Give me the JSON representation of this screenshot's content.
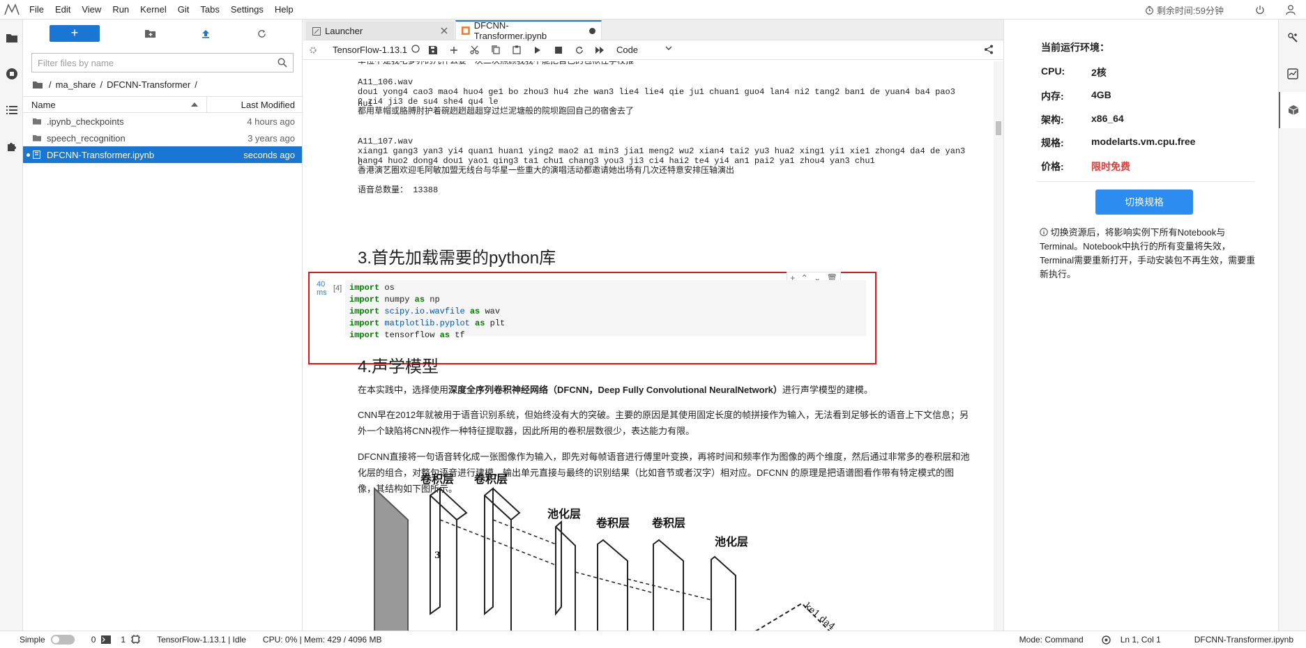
{
  "menu": [
    "File",
    "Edit",
    "View",
    "Run",
    "Kernel",
    "Git",
    "Tabs",
    "Settings",
    "Help"
  ],
  "timer": "剩余时间:59分钟",
  "filebrowser": {
    "new_label": "+",
    "filter_placeholder": "Filter files by name",
    "breadcrumb": [
      "/",
      "ma_share",
      "/",
      "DFCNN-Transformer",
      "/"
    ],
    "col_name": "Name",
    "col_modified": "Last Modified",
    "files": [
      {
        "name": ".ipynb_checkpoints",
        "modified": "4 hours ago",
        "type": "folder"
      },
      {
        "name": "speech_recognition",
        "modified": "3 years ago",
        "type": "folder"
      },
      {
        "name": "DFCNN-Transformer.ipynb",
        "modified": "seconds ago",
        "type": "notebook"
      }
    ]
  },
  "tabs": [
    {
      "label": "Launcher"
    },
    {
      "label": "DFCNN-Transformer.ipynb"
    }
  ],
  "toolbar": {
    "kernel": "TensorFlow-1.13.1",
    "cell_type": "Code"
  },
  "notebook": {
    "top_line": "单位不是我宅夢养的凡什么要一次二次照顾我我不能把自己的包袱往学校推",
    "out1_name": "A11_106.wav",
    "out1_pinyin": "dou1 yong4 cao3 mao4 huo4 ge1 bo zhou3 hu4 zhe wan3 lie4 lie4 qie ju1 chuan1 guo4 lan4 ni2 tang2 ban1 de yuan4 ba4 pao3 hui",
    "out1_pinyin2": "2 zi4 ji3 de su4 she4 qu4 le",
    "out1_text": "都用草帽或胳膊肘护着碗趔趔趄趄穿过烂泥塘般的院坝跑回自己的宿舍去了",
    "out2_name": "A11_107.wav",
    "out2_pinyin": "xiang1 gang3 yan3 yi4 quan1 huan1 ying2 mao2 a1 min3 jia1 meng2 wu2 xian4 tai2 yu3 hua2 xing1 yi1 xie1 zhong4 da4 de yan3 c",
    "out2_pinyin2": "hang4 huo2 dong4 dou1 yao1 qing3 ta1 chu1 chang3 you3 ji3 ci4 hai2 te4 yi4 an1 pai2 ya1 zhou4 yan3 chu1",
    "out2_text": "香港演艺圈欢迎毛阿敏加盟无线台与华星一些重大的演唱活动都邀请她出场有几次还特意安排压轴演出",
    "total": "语音总数量： 13388",
    "h3": "3.首先加载需要的python库",
    "exec_time": "40 ms",
    "prompt": "[4]",
    "code": [
      {
        "kw": "import",
        "mod": "os",
        "rest": ""
      },
      {
        "kw": "import",
        "mod": "numpy",
        "as": "as",
        "alias": "np"
      },
      {
        "kw": "import",
        "mod": "scipy.io.wavfile",
        "as": "as",
        "alias": "wav"
      },
      {
        "kw": "import",
        "mod": "matplotlib.pyplot",
        "as": "as",
        "alias": "plt"
      },
      {
        "kw": "import",
        "mod": "tensorflow",
        "as": "as",
        "alias": "tf"
      }
    ],
    "h4": "4.声学模型",
    "p1a": "在本实践中，选择使用",
    "p1b": "深度全序列卷积神经网络（DFCNN，Deep Fully Convolutional NeuralNetwork）",
    "p1c": "进行声学模型的建模。",
    "p2": "CNN早在2012年就被用于语音识别系统，但始终没有大的突破。主要的原因是其使用固定长度的帧拼接作为输入，无法看到足够长的语音上下文信息；另外一个缺陷将CNN视作一种特征提取器，因此所用的卷积层数很少，表达能力有限。",
    "p3": "DFCNN直接将一句语音转化成一张图像作为输入，即先对每帧语音进行傅里叶变换，再将时间和频率作为图像的两个维度，然后通过非常多的卷积层和池化层的组合，对整句语音进行建模，输出单元直接与最终的识别结果（比如音节或者汉字）相对应。DFCNN 的原理是把语谱图看作带有特定模式的图像，其结构如下图所示。",
    "fig_labels": [
      "卷积层",
      "卷积层",
      "池化层",
      "卷积层",
      "卷积层",
      "池化层",
      "3",
      "ke1 da4"
    ]
  },
  "env": {
    "title": "当前运行环境：",
    "rows": [
      {
        "k": "CPU:",
        "v": "2核"
      },
      {
        "k": "内存:",
        "v": "4GB"
      },
      {
        "k": "架构:",
        "v": "x86_64"
      },
      {
        "k": "规格:",
        "v": "modelarts.vm.cpu.free"
      },
      {
        "k": "价格:",
        "v": "限时免费"
      }
    ],
    "button": "切换规格",
    "note": "切换资源后，将影响实例下所有Notebook与Terminal。Notebook中执行的所有变量将失效，Terminal需要重新打开，手动安装包不再生效，需要重新执行。"
  },
  "status": {
    "mode_label": "Simple",
    "n1": "0",
    "n2": "1",
    "kernel": "TensorFlow-1.13.1 | Idle",
    "mem": "CPU: 0% | Mem: 429 / 4096 MB",
    "command": "Mode: Command",
    "pos": "Ln 1, Col 1",
    "file": "DFCNN-Transformer.ipynb"
  },
  "colors": {
    "accent": "#1976d2",
    "highlight_border": "#e0161b",
    "price": "#e53935",
    "button": "#2d8cf0"
  }
}
